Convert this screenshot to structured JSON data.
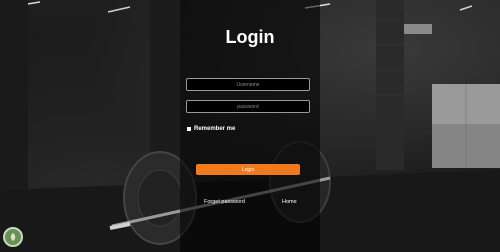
{
  "login": {
    "title": "Login",
    "username_placeholder": "Username",
    "password_placeholder": "password",
    "remember_label": "Remember me",
    "login_button": "Login",
    "forgot_password": "Forget password",
    "home": "Home"
  },
  "colors": {
    "accent": "#f07a1e",
    "panel": "rgba(0,0,0,0.55)"
  }
}
